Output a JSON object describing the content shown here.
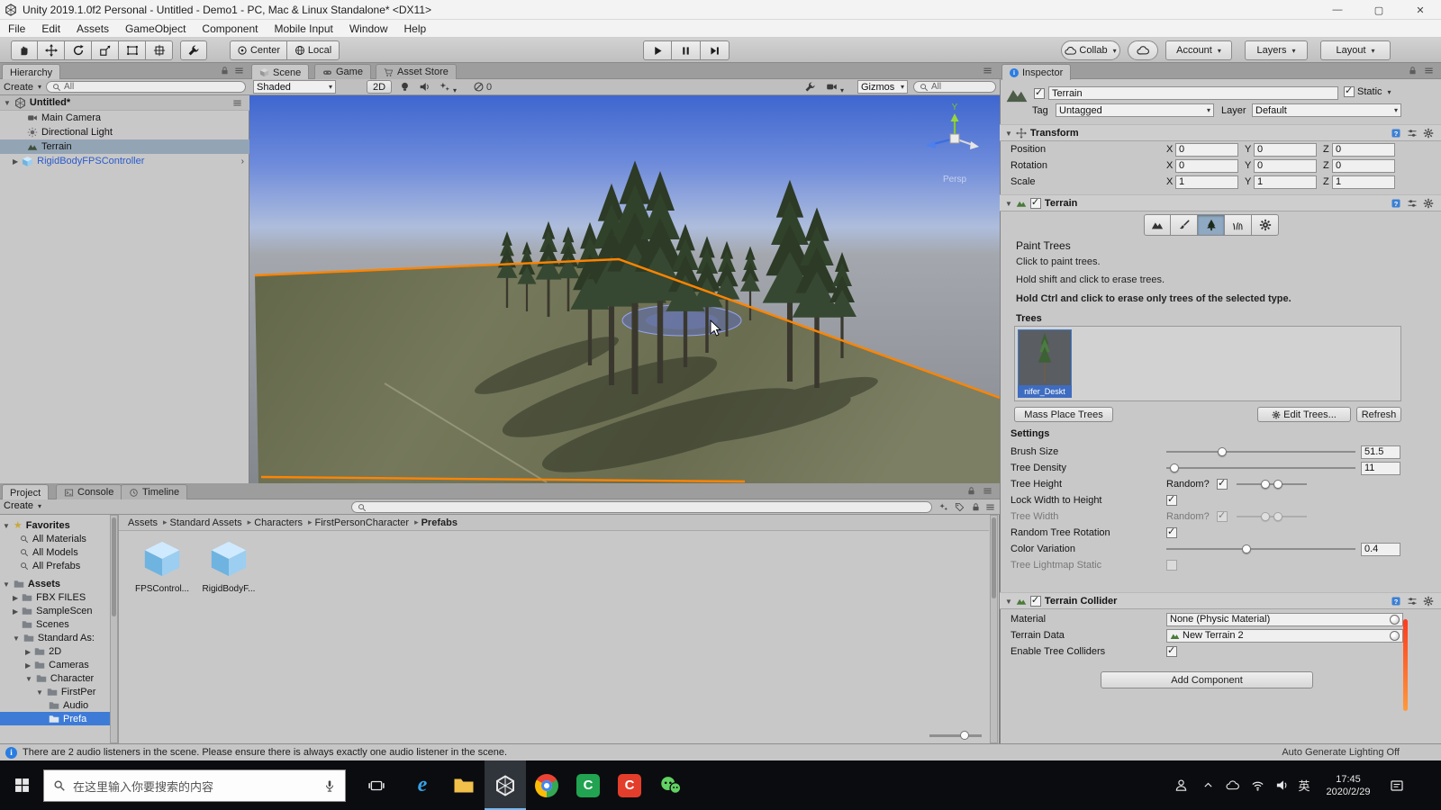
{
  "window": {
    "title": "Unity 2019.1.0f2 Personal - Untitled - Demo1 - PC, Mac & Linux Standalone* <DX11>"
  },
  "menus": [
    "File",
    "Edit",
    "Assets",
    "GameObject",
    "Component",
    "Mobile Input",
    "Window",
    "Help"
  ],
  "toolbar": {
    "pivot": "Center",
    "space": "Local",
    "collab": "Collab",
    "account": "Account",
    "layers": "Layers",
    "layout": "Layout"
  },
  "hierarchy": {
    "tab": "Hierarchy",
    "create": "Create",
    "search_text": "All",
    "scene_name": "Untitled*",
    "items": [
      "Main Camera",
      "Directional Light",
      "Terrain",
      "RigidBodyFPSController"
    ]
  },
  "scene": {
    "tabs": [
      "Scene",
      "Game",
      "Asset Store"
    ],
    "shading": "Shaded",
    "mode_2d": "2D",
    "hidden_count": "0",
    "gizmos": "Gizmos",
    "search_text": "All",
    "persp": "Persp",
    "axis_y": "Y"
  },
  "inspector": {
    "tab": "Inspector",
    "name": "Terrain",
    "static_label": "Static",
    "tag_label": "Tag",
    "tag": "Untagged",
    "layer_label": "Layer",
    "layer": "Default",
    "transform": {
      "title": "Transform",
      "axis": [
        "X",
        "Y",
        "Z"
      ],
      "rows": [
        {
          "label": "Position",
          "x": "0",
          "y": "0",
          "z": "0"
        },
        {
          "label": "Rotation",
          "x": "0",
          "y": "0",
          "z": "0"
        },
        {
          "label": "Scale",
          "x": "1",
          "y": "1",
          "z": "1"
        }
      ]
    },
    "terrain": {
      "title": "Terrain",
      "panel_title": "Paint Trees",
      "help": [
        "Click to paint trees.",
        "Hold shift and click to erase trees.",
        "Hold Ctrl and click to erase only trees of the selected type."
      ],
      "trees_label": "Trees",
      "tree_name": "nifer_Deskt",
      "mass_place": "Mass Place Trees",
      "edit_trees": "Edit Trees...",
      "refresh": "Refresh",
      "settings_title": "Settings",
      "brush_size_label": "Brush Size",
      "brush_size": "51.5",
      "tree_density_label": "Tree Density",
      "tree_density": "11",
      "tree_height_label": "Tree Height",
      "random_label": "Random?",
      "lock_width_label": "Lock Width to Height",
      "tree_width_label": "Tree Width",
      "random_rotation_label": "Random Tree Rotation",
      "color_variation_label": "Color Variation",
      "color_variation": "0.4",
      "lightmap_label": "Tree Lightmap Static"
    },
    "collider": {
      "title": "Terrain Collider",
      "material_label": "Material",
      "material": "None (Physic Material)",
      "terrain_data_label": "Terrain Data",
      "terrain_data": "New Terrain 2",
      "tree_colliders_label": "Enable Tree Colliders"
    },
    "add_component": "Add Component"
  },
  "project": {
    "tabs": [
      "Project",
      "Console",
      "Timeline"
    ],
    "create": "Create",
    "favorites_label": "Favorites",
    "favorites": [
      "All Materials",
      "All Models",
      "All Prefabs"
    ],
    "assets_root": "Assets",
    "folders": [
      "FBX FILES",
      "SampleScen",
      "Scenes",
      "Standard As:",
      "2D",
      "Cameras",
      "Character",
      "FirstPer",
      "Audio",
      "Prefa"
    ],
    "breadcrumb": [
      "Assets",
      "Standard Assets",
      "Characters",
      "FirstPersonCharacter",
      "Prefabs"
    ],
    "files": [
      "FPSControl...",
      "RigidBodyF..."
    ]
  },
  "status": {
    "message": "There are 2 audio listeners in the scene. Please ensure there is always exactly one audio listener in the scene.",
    "lighting": "Auto Generate Lighting Off"
  },
  "taskbar": {
    "search_placeholder": "在这里输入你要搜索的内容",
    "lang": "英",
    "time": "17:45",
    "date": "2020/2/29"
  }
}
